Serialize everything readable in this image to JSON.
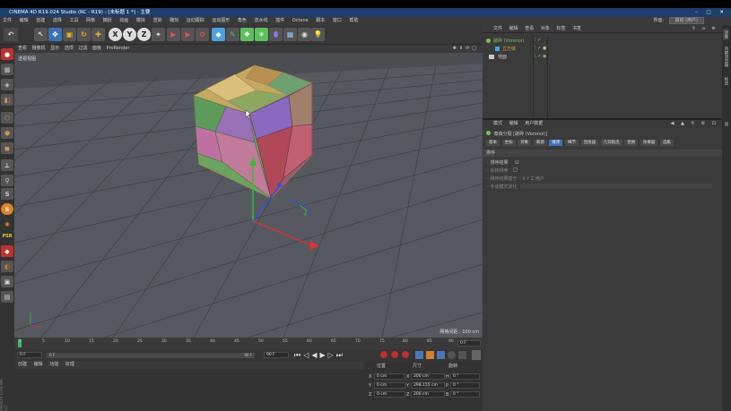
{
  "window": {
    "title": "CINEMA 4D R19.024 Studio (RC - R19) - [未标题 1 *] - 主要",
    "buttons": "–  ▢  ✕"
  },
  "menubar": {
    "items": [
      "文件",
      "编辑",
      "创建",
      "选择",
      "工具",
      "网格",
      "捕捉",
      "动画",
      "模拟",
      "渲染",
      "雕刻",
      "运动跟踪",
      "运动图形",
      "角色",
      "流水线",
      "插件",
      "Octane",
      "脚本",
      "窗口",
      "帮助"
    ],
    "layout_label": "界面:",
    "layout_value": "启动 (用户)"
  },
  "viewport": {
    "menu": [
      "查看",
      "摄像机",
      "显示",
      "选项",
      "过滤",
      "面板",
      "ProRender"
    ],
    "label": "透视视图",
    "grid_spacing": "网格间距 : 100 cm"
  },
  "timeline": {
    "ticks": [
      "0",
      "5",
      "10",
      "15",
      "20",
      "25",
      "30",
      "35",
      "40",
      "45",
      "50",
      "55",
      "60",
      "65",
      "70",
      "75",
      "80",
      "85",
      "90"
    ],
    "current_frame": "0 F",
    "start_field": "0 F",
    "start_field2": "0 F",
    "end_field": "90 F",
    "end_field2": "90 F"
  },
  "material_panel": {
    "menu": [
      "创建",
      "编辑",
      "功能",
      "纹理"
    ]
  },
  "coordinates": {
    "headers": [
      "位置",
      "尺寸",
      "旋转"
    ],
    "rows": [
      {
        "axis": "X",
        "pos": "0 cm",
        "size": "200 cm",
        "rot_label": "H",
        "rot": "0 °"
      },
      {
        "axis": "Y",
        "pos": "0 cm",
        "size": "298.155 cm",
        "rot_label": "P",
        "rot": "0 °"
      },
      {
        "axis": "Z",
        "pos": "0 cm",
        "size": "200 cm",
        "rot_label": "B",
        "rot": "0 °"
      }
    ]
  },
  "object_manager": {
    "menu": [
      "文件",
      "编辑",
      "查看",
      "对象",
      "标签",
      "书签"
    ],
    "objects": [
      {
        "name": "破碎 (Voronoi)",
        "color": "#7cc15a"
      },
      {
        "name": "立方体",
        "color": "#4aa3e0"
      },
      {
        "name": "地面",
        "color": "#c8c8c8"
      }
    ]
  },
  "attribute_manager": {
    "menu": [
      "模式",
      "编辑",
      "用户数据"
    ],
    "object_label": "泰森分裂 [破碎 (Voronoi)]",
    "tabs": [
      "基本",
      "坐标",
      "对象",
      "来源",
      "排序",
      "细节",
      "连接器",
      "几何粘连",
      "变换",
      "效果器",
      "选集"
    ],
    "active_tab": "排序",
    "section": "排序",
    "fields": [
      {
        "label": "排序结果",
        "value": "☑"
      },
      {
        "label": "反转排序",
        "value": ""
      },
      {
        "label": "排序结果基于",
        "value": "X   Y   Z   用户"
      },
      {
        "label": "手动模式变化",
        "value": ""
      }
    ]
  },
  "side_tabs": [
    "对象",
    "内容浏览器",
    "构造",
    "层"
  ],
  "brand": "MAXON CINEMA 4D",
  "colors": {
    "accent": "#3b73b4",
    "titlebar": "#1d3f6e",
    "viewport_bg": "#4a4d52"
  }
}
